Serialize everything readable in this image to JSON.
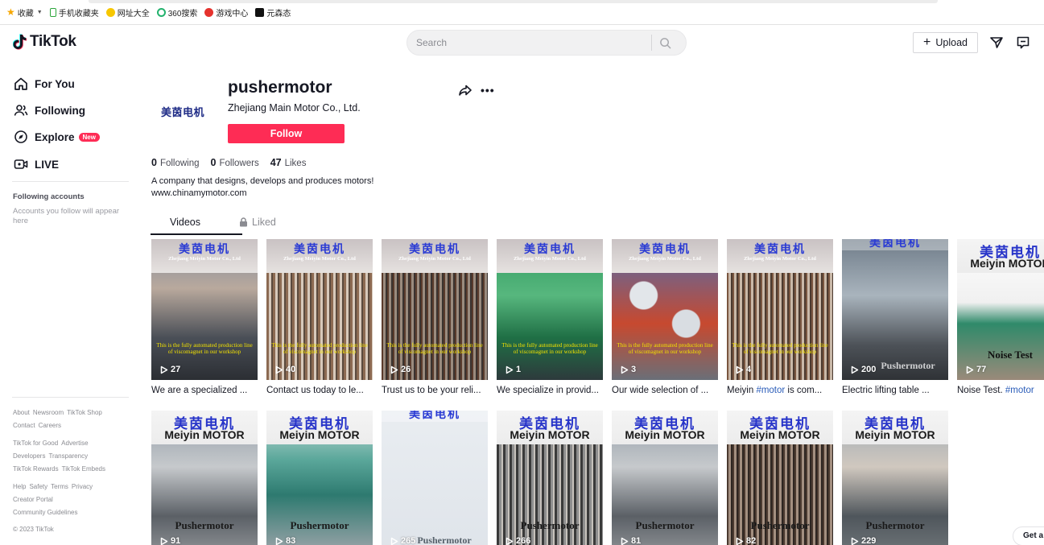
{
  "bookmarks": [
    {
      "label": "收藏",
      "icon": "star-icon"
    },
    {
      "label": "手机收藏夹",
      "icon": "phone-icon"
    },
    {
      "label": "网址大全",
      "icon": "site-icon"
    },
    {
      "label": "360搜索",
      "icon": "search360-icon"
    },
    {
      "label": "游戏中心",
      "icon": "game-icon"
    },
    {
      "label": "元森态",
      "icon": "tiktok-small-icon"
    }
  ],
  "header": {
    "logo": "TikTok",
    "search_placeholder": "Search",
    "upload_label": "Upload"
  },
  "sidebar": {
    "nav": [
      {
        "label": "For You",
        "icon": "home-icon"
      },
      {
        "label": "Following",
        "icon": "users-icon"
      },
      {
        "label": "Explore",
        "icon": "compass-icon",
        "badge": "New"
      },
      {
        "label": "LIVE",
        "icon": "live-icon"
      }
    ],
    "following_title": "Following accounts",
    "following_empty": "Accounts you follow will appear here",
    "footer": [
      [
        "About",
        "Newsroom",
        "TikTok Shop"
      ],
      [
        "Contact",
        "Careers"
      ],
      [
        "TikTok for Good",
        "Advertise"
      ],
      [
        "Developers",
        "Transparency"
      ],
      [
        "TikTok Rewards",
        "TikTok Embeds"
      ],
      [
        "Help",
        "Safety",
        "Terms",
        "Privacy"
      ],
      [
        "Creator Portal"
      ],
      [
        "Community Guidelines"
      ],
      [
        "© 2023 TikTok"
      ]
    ]
  },
  "profile": {
    "avatar_text": "美茵电机",
    "username": "pushermotor",
    "nickname": "Zhejiang Main Motor Co., Ltd.",
    "follow_label": "Follow",
    "following_count": "0",
    "following_label": "Following",
    "followers_count": "0",
    "followers_label": "Followers",
    "likes_count": "47",
    "likes_label": "Likes",
    "bio_line1": "A company that designs, develops and produces motors!",
    "bio_line2": "www.chinamymotor.com"
  },
  "tabs": {
    "videos": "Videos",
    "liked": "Liked"
  },
  "videos_row1": [
    {
      "views": "27",
      "desc": "We are a specialized ...",
      "brand_cn": "美茵电机",
      "brand_sub": "Zhejiang Meiyin Motor Co., Ltd",
      "caption": "This is the fully automated production line of viscomagnet in our workshop"
    },
    {
      "views": "40",
      "desc": "Contact us today to le...",
      "brand_cn": "美茵电机",
      "brand_sub": "Zhejiang Meiyin Motor Co., Ltd",
      "caption": "This is the fully automated production line of viscomagnet in our workshop"
    },
    {
      "views": "26",
      "desc": "Trust us to be your reli...",
      "brand_cn": "美茵电机",
      "brand_sub": "Zhejiang Meiyin Motor Co., Ltd",
      "caption": "This is the fully automated production line of viscomagnet in our workshop"
    },
    {
      "views": "1",
      "desc": "We specialize in provid...",
      "brand_cn": "美茵电机",
      "brand_sub": "Zhejiang Meiyin Motor Co., Ltd",
      "caption": "This is the fully automated production line of viscomagnet in our workshop"
    },
    {
      "views": "3",
      "desc": "Our wide selection of ...",
      "brand_cn": "美茵电机",
      "brand_sub": "Zhejiang Meiyin Motor Co., Ltd",
      "caption": "This is the fully automated production line of viscomagnet in our workshop"
    },
    {
      "views": "4",
      "desc_pre": "Meiyin ",
      "desc_tag": "#motor",
      "desc_post": " is com...",
      "brand_cn": "美茵电机",
      "brand_sub": "Zhejiang Meiyin Motor Co., Ltd",
      "caption": "This is the fully automated production line of viscomagnet in our workshop"
    },
    {
      "views": "200",
      "desc": "Electric lifting table ...",
      "brand_cn": "美茵电机",
      "watermark": "Pushermotor"
    },
    {
      "views": "77",
      "desc_pre": "Noise Test. ",
      "desc_tag": "#motor",
      "desc_post": "",
      "brand_cn": "美茵电机",
      "brand_en": "Meiyin MOTOR",
      "overlay": "Noise Test"
    }
  ],
  "videos_row2": [
    {
      "views": "91",
      "brand_cn": "美茵电机",
      "brand_en": "Meiyin MOTOR",
      "bottom": "Pushermotor"
    },
    {
      "views": "83",
      "brand_cn": "美茵电机",
      "brand_en": "Meiyin MOTOR",
      "bottom": "Pushermotor"
    },
    {
      "views": "265",
      "brand_cn": "美茵电机",
      "bottom": "Pushermotor"
    },
    {
      "views": "266",
      "brand_cn": "美茵电机",
      "brand_en": "Meiyin MOTOR",
      "bottom": "Pushermotor"
    },
    {
      "views": "81",
      "brand_cn": "美茵电机",
      "brand_en": "Meiyin MOTOR",
      "bottom": "Pushermotor"
    },
    {
      "views": "82",
      "brand_cn": "美茵电机",
      "brand_en": "Meiyin MOTOR",
      "bottom": "Pushermotor"
    },
    {
      "views": "229",
      "brand_cn": "美茵电机",
      "brand_en": "Meiyin MOTOR",
      "bottom": "Pushermotor"
    }
  ],
  "get_app": "Get a",
  "colors": {
    "accent": "#fe2c55",
    "text": "#161823",
    "hashtag": "#2b5db9"
  }
}
